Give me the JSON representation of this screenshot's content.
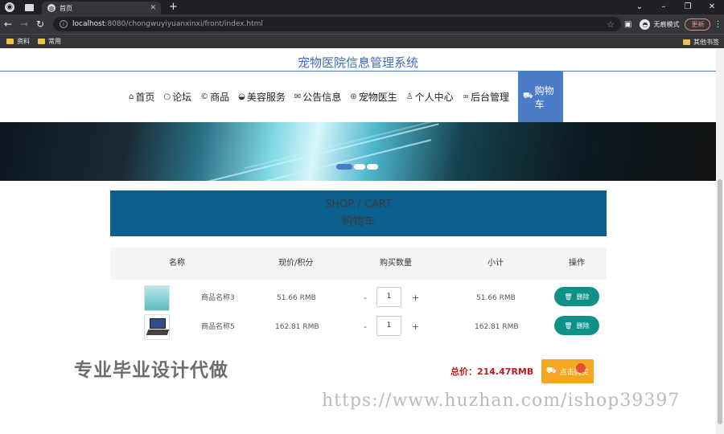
{
  "browser": {
    "tab_title": "首页",
    "url_host": "localhost",
    "url_rest": ":8080/chongwuyiyuanxinxi/front/index.html",
    "incognito_label": "无痕模式",
    "update_label": "更新",
    "bookmarks": [
      "资料",
      "常用"
    ],
    "bookmarks_right": "其他书签"
  },
  "site": {
    "title": "宠物医院信息管理系统",
    "nav": [
      {
        "icon": "home-icon",
        "label": "首页"
      },
      {
        "icon": "forum-icon",
        "label": "论坛"
      },
      {
        "icon": "goods-icon",
        "label": "商品"
      },
      {
        "icon": "beauty-icon",
        "label": "美容服务"
      },
      {
        "icon": "notice-icon",
        "label": "公告信息"
      },
      {
        "icon": "doctor-icon",
        "label": "宠物医生"
      },
      {
        "icon": "user-icon",
        "label": "个人中心"
      },
      {
        "icon": "link-icon",
        "label": "后台管理"
      },
      {
        "icon": "cart-icon",
        "label": "购物车"
      }
    ]
  },
  "cart": {
    "header_en": "SHOP / CART",
    "header_cn": "购物车",
    "columns": [
      "名称",
      "现价/积分",
      "购买数量",
      "小计",
      "操作"
    ],
    "items": [
      {
        "name": "商品名称3",
        "price": "51.66 RMB",
        "qty": "1",
        "subtotal": "51.66 RMB",
        "delete_label": "删除"
      },
      {
        "name": "商品名称5",
        "price": "162.81 RMB",
        "qty": "1",
        "subtotal": "162.81 RMB",
        "delete_label": "删除"
      }
    ],
    "qty_minus": "-",
    "qty_plus": "+",
    "total": "总价：214.47RMB",
    "checkout_label": "点击购买"
  },
  "watermarks": {
    "left": "专业毕业设计代做",
    "right": "https://www.huzhan.com/ishop39397"
  },
  "colors": {
    "accent": "#4a7cc7",
    "header_blue": "#0b5f8f",
    "delete_green": "#109187",
    "checkout_orange": "#f5a623",
    "price_red": "#c8161d"
  }
}
